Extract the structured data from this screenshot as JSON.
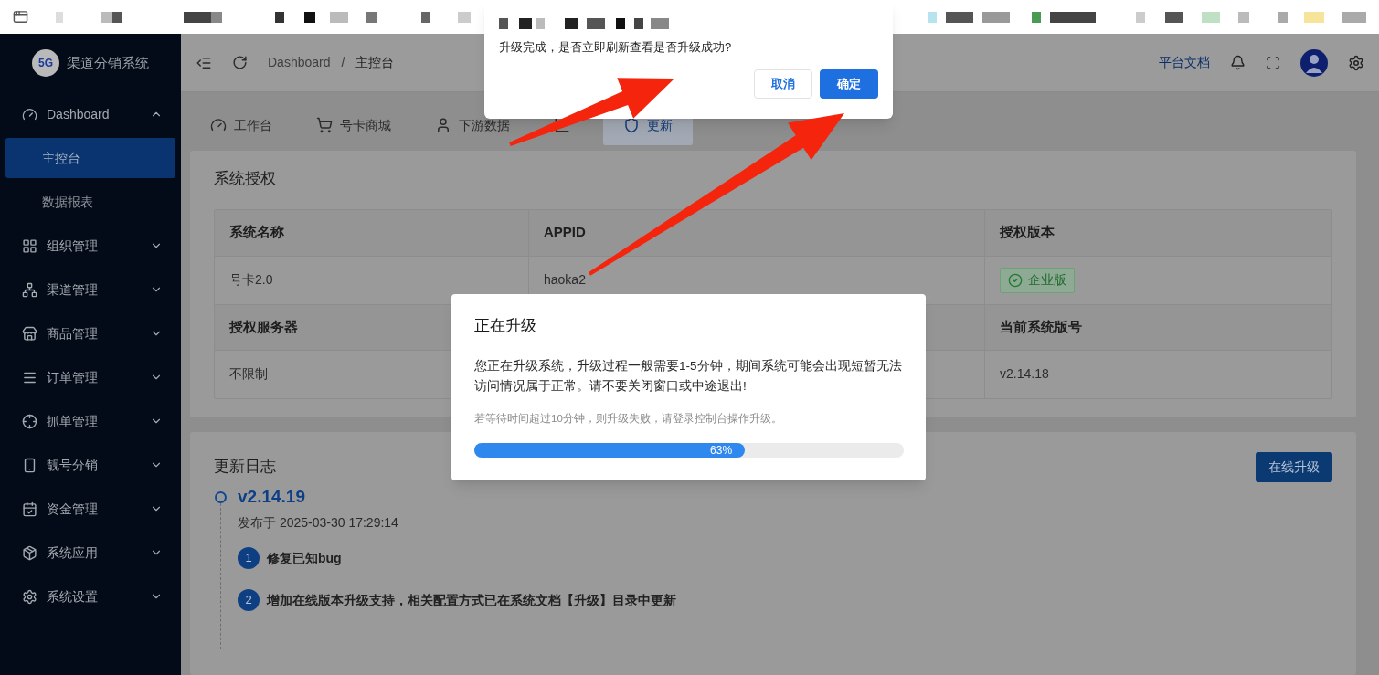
{
  "confirm_dialog": {
    "message": "升级完成，是否立即刷新查看是否升级成功?",
    "buttons": [
      {
        "label": "取消",
        "primary": false
      },
      {
        "label": "确定",
        "primary": true
      }
    ]
  },
  "sidebar": {
    "logo_text": "5G",
    "title": "渠道分销系统",
    "items": [
      {
        "label": "Dashboard",
        "expanded": true,
        "children": [
          {
            "label": "主控台",
            "selected": true
          },
          {
            "label": "数据报表",
            "selected": false
          }
        ]
      },
      {
        "label": "组织管理",
        "expanded": false
      },
      {
        "label": "渠道管理",
        "expanded": false
      },
      {
        "label": "商品管理",
        "expanded": false
      },
      {
        "label": "订单管理",
        "expanded": false
      },
      {
        "label": "抓单管理",
        "expanded": false
      },
      {
        "label": "靓号分销",
        "expanded": false
      },
      {
        "label": "资金管理",
        "expanded": false
      },
      {
        "label": "系统应用",
        "expanded": false
      },
      {
        "label": "系统设置",
        "expanded": false
      }
    ]
  },
  "header": {
    "breadcrumb": [
      "Dashboard",
      "主控台"
    ],
    "separator": "/",
    "docs_link": "平台文档"
  },
  "tabs": [
    {
      "label": "工作台",
      "selected": false
    },
    {
      "label": "号卡商城",
      "selected": false
    },
    {
      "label": "下游数据",
      "selected": false
    },
    {
      "selected": false
    },
    {
      "label": "更新",
      "selected": true
    }
  ],
  "license": {
    "title": "系统授权",
    "rows": [
      {
        "kind": "header",
        "cells": [
          "系统名称",
          "APPID",
          "授权版本"
        ]
      },
      {
        "kind": "value",
        "cells": [
          "号卡2.0",
          "haoka2",
          null
        ],
        "tag": "企业版"
      },
      {
        "kind": "header",
        "cells": [
          "授权服务器",
          null,
          "当前系统版号"
        ]
      },
      {
        "kind": "value",
        "cells": [
          "不限制",
          null,
          "v2.14.18"
        ]
      }
    ]
  },
  "changelog": {
    "title": "更新日志",
    "button": "在线升级",
    "entries": [
      {
        "version": "v2.14.19",
        "date": "发布于 2025-03-30 17:29:14",
        "items": [
          {
            "number": "1",
            "text": "修复已知bug"
          },
          {
            "number": "2",
            "text": "增加在线版本升级支持，相关配置方式已在系统文档【升级】目录中更新"
          }
        ]
      }
    ]
  },
  "upgrade_modal": {
    "title": "正在升级",
    "body": "您正在升级系统，升级过程一般需要1-5分钟，期间系统可能会出现短暂无法访问情况属于正常。请不要关闭窗口或中途退出!",
    "note": "若等待时间超过10分钟，则升级失败，请登录控制台操作升级。",
    "progress": {
      "level": 0.63,
      "label": "63%"
    }
  }
}
